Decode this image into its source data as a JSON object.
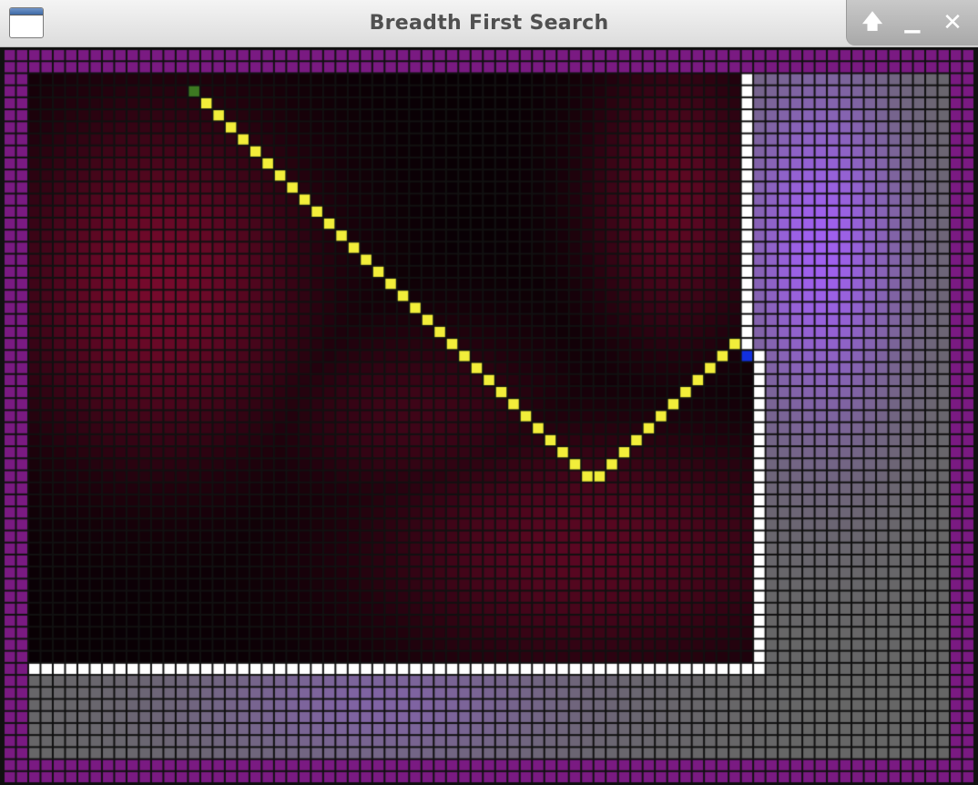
{
  "window": {
    "title": "Breadth First Search",
    "controls": {
      "maximize_glyph": "🡅",
      "minimize_glyph": "▁",
      "close_glyph": "✕",
      "maximize_icon": "arrow-up-icon",
      "minimize_icon": "minimize-icon",
      "close_icon": "close-icon"
    }
  },
  "grid": {
    "columns": 79,
    "rows": 61,
    "start": {
      "col": 15,
      "row": 3,
      "color": "#3d7a22"
    },
    "goal": {
      "col": 60,
      "row": 25,
      "color": "#1230e0"
    },
    "path_color": "#f2ee3a",
    "wall_color": "#ffffff",
    "border_color": "#7a1a82",
    "gridline_color": "#111111",
    "wall_vertical": {
      "col": 60,
      "row_from": 2,
      "row_to": 24
    },
    "wall_vertical_lower": {
      "col": 61,
      "row_from": 25,
      "row_to": 51
    },
    "wall_horizontal": {
      "row": 51,
      "col_from": 2,
      "col_to": 61
    },
    "path_cells": [
      [
        16,
        4
      ],
      [
        17,
        5
      ],
      [
        18,
        6
      ],
      [
        19,
        7
      ],
      [
        20,
        8
      ],
      [
        21,
        9
      ],
      [
        22,
        10
      ],
      [
        23,
        11
      ],
      [
        24,
        12
      ],
      [
        25,
        13
      ],
      [
        26,
        14
      ],
      [
        27,
        15
      ],
      [
        28,
        16
      ],
      [
        29,
        17
      ],
      [
        30,
        18
      ],
      [
        31,
        19
      ],
      [
        32,
        20
      ],
      [
        33,
        21
      ],
      [
        34,
        22
      ],
      [
        35,
        23
      ],
      [
        36,
        24
      ],
      [
        37,
        25
      ],
      [
        38,
        26
      ],
      [
        39,
        27
      ],
      [
        40,
        28
      ],
      [
        41,
        29
      ],
      [
        42,
        30
      ],
      [
        43,
        31
      ],
      [
        44,
        32
      ],
      [
        45,
        33
      ],
      [
        46,
        34
      ],
      [
        47,
        35
      ],
      [
        48,
        35
      ],
      [
        49,
        34
      ],
      [
        50,
        33
      ],
      [
        51,
        32
      ],
      [
        52,
        31
      ],
      [
        53,
        30
      ],
      [
        54,
        29
      ],
      [
        55,
        28
      ],
      [
        56,
        27
      ],
      [
        57,
        26
      ],
      [
        58,
        25
      ],
      [
        59,
        24
      ]
    ]
  }
}
